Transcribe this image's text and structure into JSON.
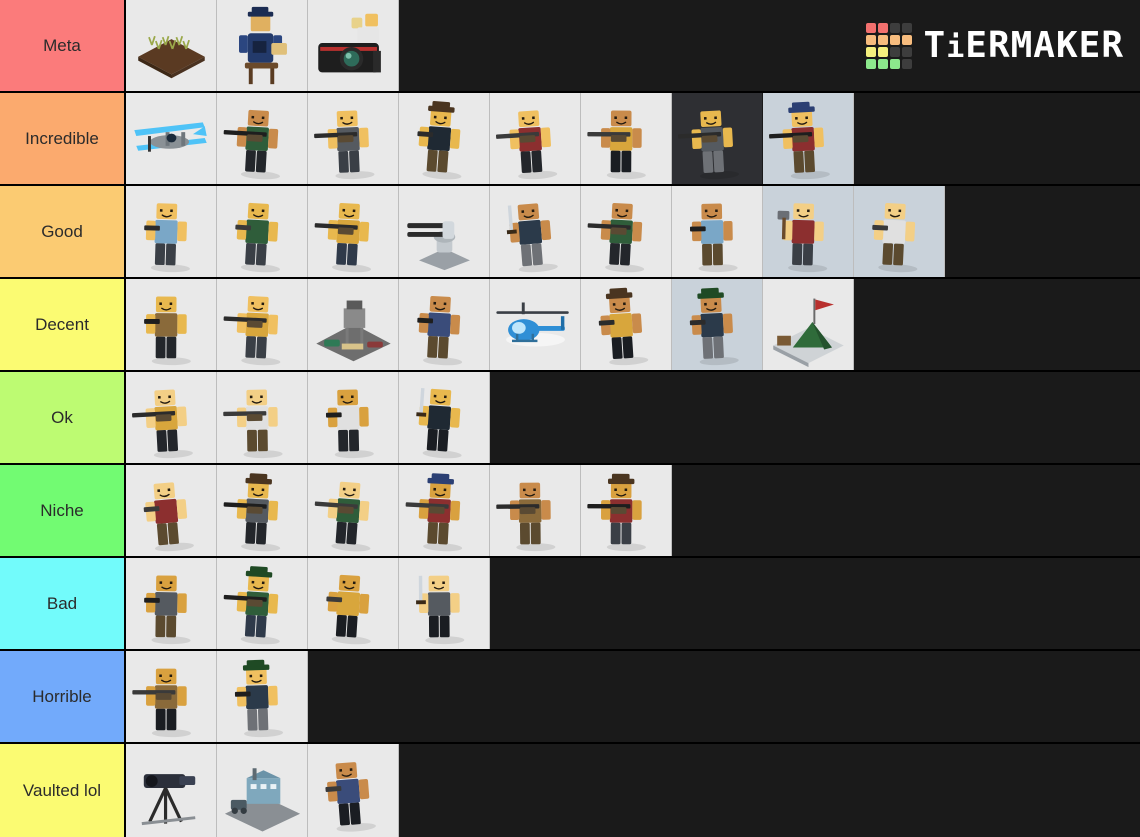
{
  "app": {
    "name": "TierMaker",
    "logo_text_parts": [
      "T",
      "i",
      "ERMAKER"
    ],
    "logo_grid_colors": [
      "#f2706e",
      "#f2706e",
      "#3d3d3d",
      "#3d3d3d",
      "#f7bc7e",
      "#f7bc7e",
      "#f7bc7e",
      "#f7bc7e",
      "#f5f07e",
      "#f5f07e",
      "#3d3d3d",
      "#3d3d3d",
      "#8ce88c",
      "#8ce88c",
      "#8ce88c",
      "#3d3d3d"
    ],
    "background_color": "#1a1a1a",
    "tile_background": "#e9e9e9"
  },
  "tiers": [
    {
      "label": "Meta",
      "color": "#fb7b7b",
      "items": [
        {
          "name": "farm-plot",
          "bg": "light"
        },
        {
          "name": "police-officer-at-desk",
          "bg": "light"
        },
        {
          "name": "camera-operator",
          "bg": "light"
        }
      ]
    },
    {
      "label": "Incredible",
      "color": "#fbaa6e",
      "items": [
        {
          "name": "biplane-aircraft",
          "bg": "light"
        },
        {
          "name": "mounted-machine-gunner",
          "bg": "light"
        },
        {
          "name": "rocket-launcher-soldier",
          "bg": "light"
        },
        {
          "name": "cowboy-dual-pistols",
          "bg": "light"
        },
        {
          "name": "minigun-gunner",
          "bg": "light"
        },
        {
          "name": "flamethrower-soldier",
          "bg": "light"
        },
        {
          "name": "sniper-portrait-render",
          "bg": "dark"
        },
        {
          "name": "blue-police-rifleman",
          "bg": "blue"
        }
      ]
    },
    {
      "label": "Good",
      "color": "#fbcb72",
      "items": [
        {
          "name": "medic-with-medkit",
          "bg": "light"
        },
        {
          "name": "spy-with-pistol",
          "bg": "light"
        },
        {
          "name": "heavy-gunner-red-shirt",
          "bg": "light"
        },
        {
          "name": "automatic-turret",
          "bg": "light"
        },
        {
          "name": "swordsman",
          "bg": "light"
        },
        {
          "name": "rifleman-gold",
          "bg": "light"
        },
        {
          "name": "pistol-shooter-gold",
          "bg": "light"
        },
        {
          "name": "hammer-wielder-winter-camo",
          "bg": "blue"
        },
        {
          "name": "tactical-soldier",
          "bg": "blue"
        }
      ]
    },
    {
      "label": "Decent",
      "color": "#fbfb72",
      "items": [
        {
          "name": "grenade-thrower",
          "bg": "light"
        },
        {
          "name": "green-rifleman",
          "bg": "light"
        },
        {
          "name": "watchtower-base",
          "bg": "light"
        },
        {
          "name": "suited-agent-with-pistol",
          "bg": "light"
        },
        {
          "name": "helicopter",
          "bg": "light"
        },
        {
          "name": "cowboy-with-revolver",
          "bg": "light"
        },
        {
          "name": "camera-operator-green-visor",
          "bg": "blue"
        },
        {
          "name": "camp-tent-with-flag",
          "bg": "light"
        }
      ]
    },
    {
      "label": "Ok",
      "color": "#bdfb72",
      "items": [
        {
          "name": "sniper-orange-vest",
          "bg": "light"
        },
        {
          "name": "sniper-olive-vest",
          "bg": "light"
        },
        {
          "name": "thrower-white-outfit",
          "bg": "light"
        },
        {
          "name": "archer-with-bow",
          "bg": "light"
        }
      ]
    },
    {
      "label": "Niche",
      "color": "#72fb72",
      "items": [
        {
          "name": "pistol-user-grey",
          "bg": "light"
        },
        {
          "name": "paintball-sniper-blue",
          "bg": "light"
        },
        {
          "name": "flamethrower-maroon",
          "bg": "light"
        },
        {
          "name": "blue-cap-gunner",
          "bg": "light"
        },
        {
          "name": "smg-user-light-blue",
          "bg": "light"
        },
        {
          "name": "hat-rifleman-red",
          "bg": "light"
        }
      ]
    },
    {
      "label": "Bad",
      "color": "#72fbfb",
      "items": [
        {
          "name": "trumpet-player",
          "bg": "light"
        },
        {
          "name": "mortar-operator-green",
          "bg": "light"
        },
        {
          "name": "dual-wielder-grey",
          "bg": "light"
        },
        {
          "name": "knife-wielder-black",
          "bg": "light"
        }
      ]
    },
    {
      "label": "Horrible",
      "color": "#72aafb",
      "items": [
        {
          "name": "mint-shirt-gunner",
          "bg": "light"
        },
        {
          "name": "green-uniform-shooter",
          "bg": "light"
        }
      ]
    },
    {
      "label": "Vaulted lol",
      "color": "#fbfb72",
      "items": [
        {
          "name": "tripod-mounted-gun",
          "bg": "light"
        },
        {
          "name": "factory-building",
          "bg": "light"
        },
        {
          "name": "dual-wielding-figure",
          "bg": "light"
        }
      ]
    }
  ]
}
